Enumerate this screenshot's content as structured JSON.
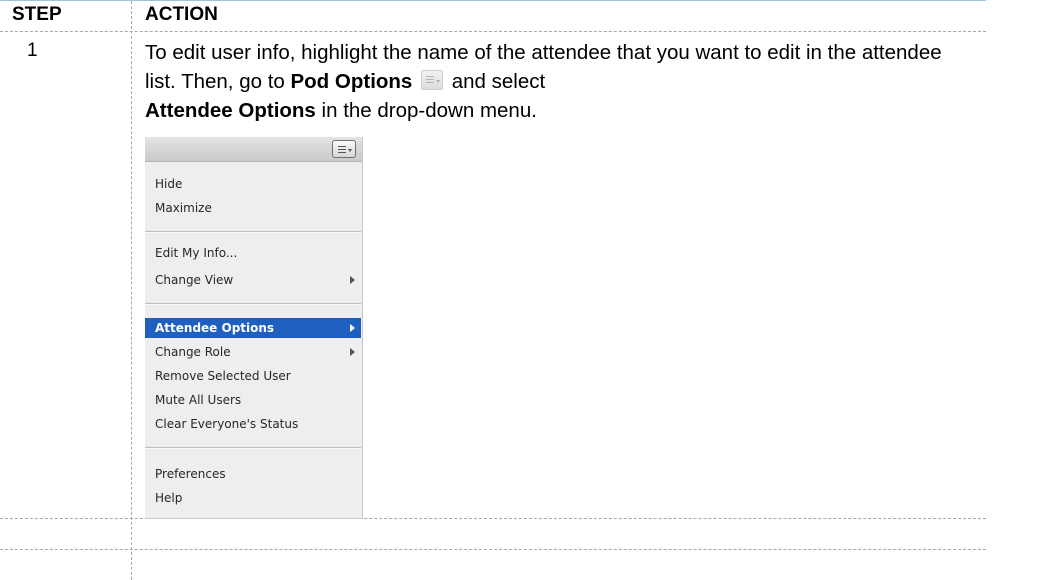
{
  "table": {
    "header_step": "STEP",
    "header_action": "ACTION",
    "step_number": "1",
    "instruction": {
      "part1": "To edit user info, highlight the name of the attendee that you want to edit in the attendee list. Then, go to ",
      "bold1": "Pod Options",
      "part2": " and select ",
      "bold2": "Attendee Options",
      "part3": " in the drop-down menu."
    }
  },
  "menu": {
    "items": [
      {
        "label": "Hide"
      },
      {
        "label": "Maximize"
      },
      {
        "label": "Edit My Info..."
      },
      {
        "label": "Change View",
        "submenu": true
      },
      {
        "label": "Attendee Options",
        "submenu": true,
        "highlighted": true
      },
      {
        "label": "Change Role",
        "submenu": true
      },
      {
        "label": "Remove Selected User"
      },
      {
        "label": "Mute All Users"
      },
      {
        "label": "Clear Everyone's Status"
      },
      {
        "label": "Preferences"
      },
      {
        "label": "Help"
      }
    ],
    "highlight_color": "#1e5fbf",
    "icons": [
      "pod-options-icon",
      "submenu-arrow-icon"
    ]
  }
}
